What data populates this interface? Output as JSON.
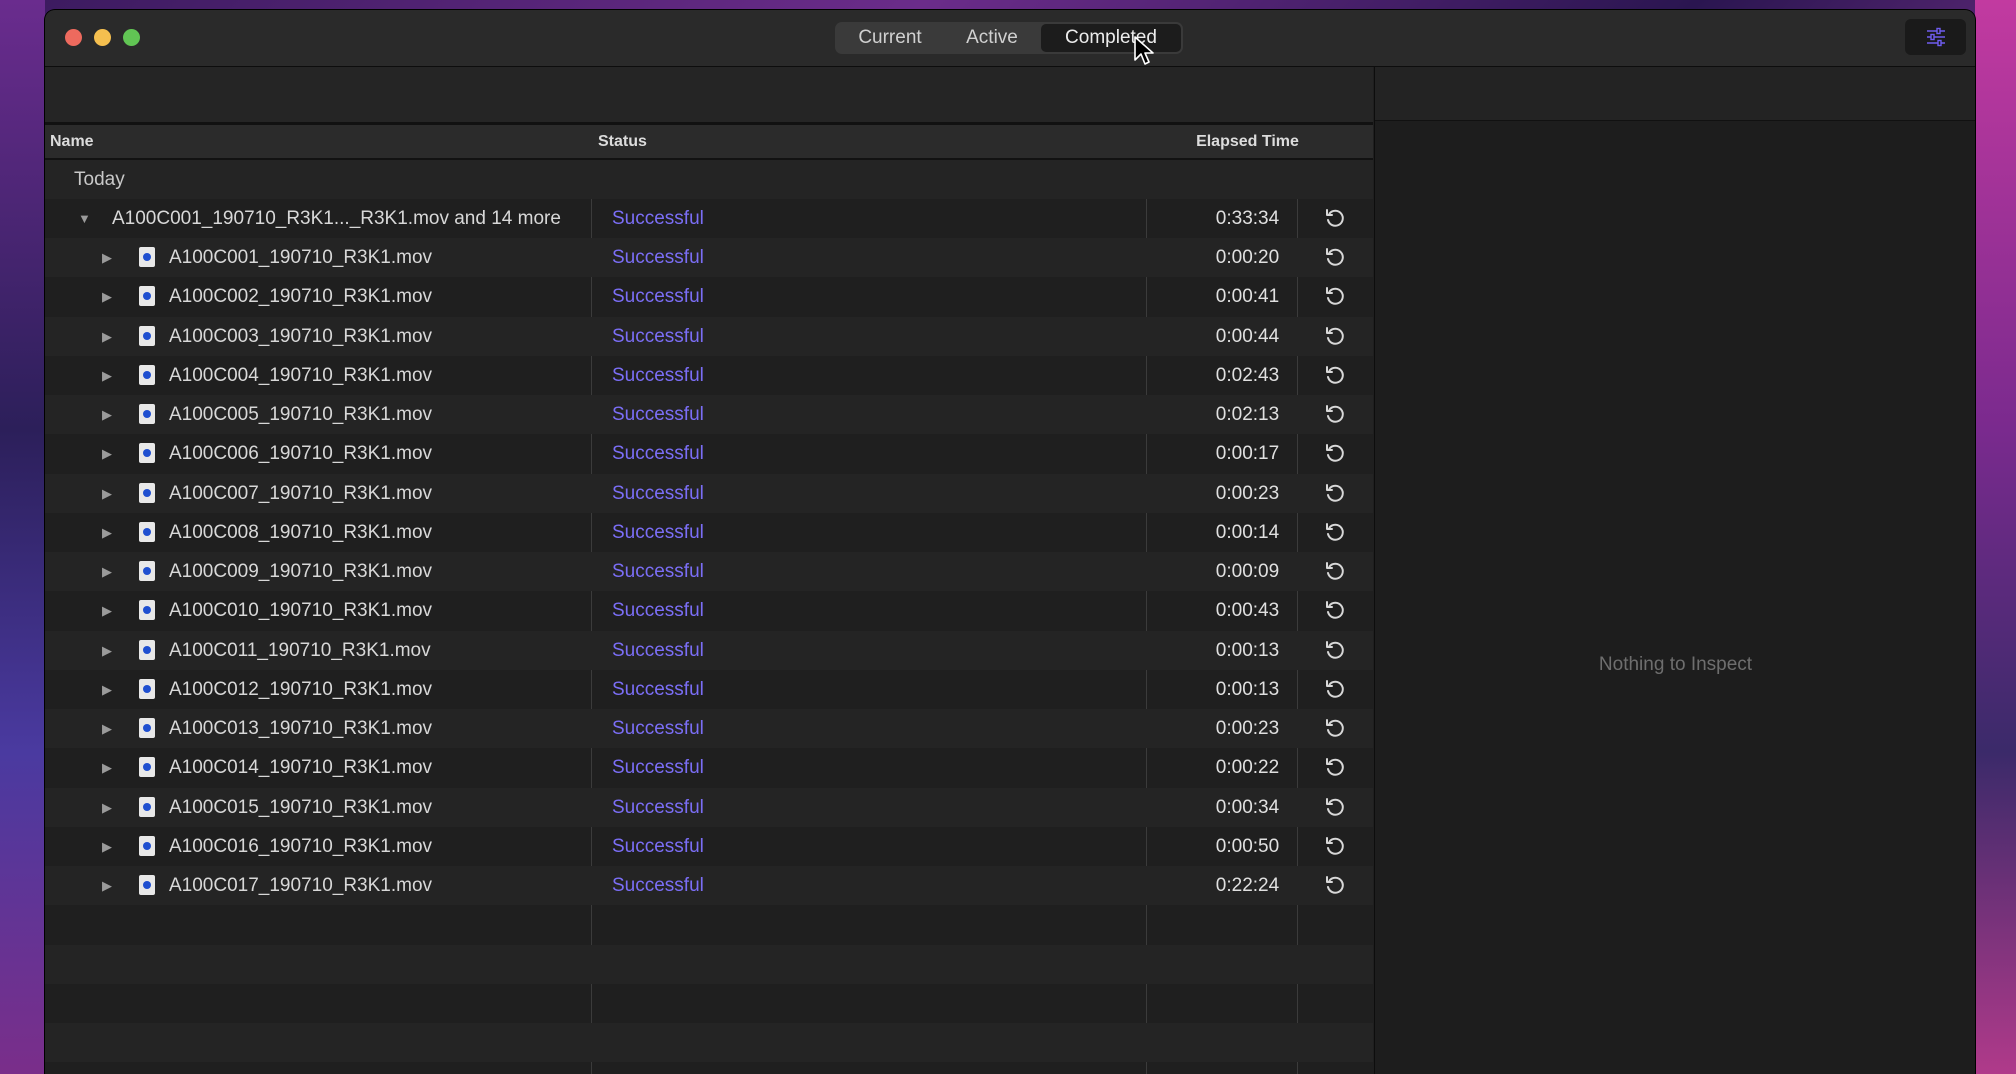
{
  "window": {
    "tabs": [
      {
        "label": "Current"
      },
      {
        "label": "Active"
      },
      {
        "label": "Completed",
        "selected": true
      }
    ],
    "inspector_toggle_icon": "sliders-icon"
  },
  "table": {
    "columns": {
      "name": "Name",
      "status": "Status",
      "elapsed": "Elapsed Time"
    },
    "group_label": "Today",
    "batch": {
      "name": "A100C001_190710_R3K1..._R3K1.mov and 14 more",
      "status": "Successful",
      "elapsed": "0:33:34",
      "expanded": true
    },
    "files": [
      {
        "name": "A100C001_190710_R3K1.mov",
        "status": "Successful",
        "elapsed": "0:00:20"
      },
      {
        "name": "A100C002_190710_R3K1.mov",
        "status": "Successful",
        "elapsed": "0:00:41"
      },
      {
        "name": "A100C003_190710_R3K1.mov",
        "status": "Successful",
        "elapsed": "0:00:44"
      },
      {
        "name": "A100C004_190710_R3K1.mov",
        "status": "Successful",
        "elapsed": "0:02:43"
      },
      {
        "name": "A100C005_190710_R3K1.mov",
        "status": "Successful",
        "elapsed": "0:02:13"
      },
      {
        "name": "A100C006_190710_R3K1.mov",
        "status": "Successful",
        "elapsed": "0:00:17"
      },
      {
        "name": "A100C007_190710_R3K1.mov",
        "status": "Successful",
        "elapsed": "0:00:23"
      },
      {
        "name": "A100C008_190710_R3K1.mov",
        "status": "Successful",
        "elapsed": "0:00:14"
      },
      {
        "name": "A100C009_190710_R3K1.mov",
        "status": "Successful",
        "elapsed": "0:00:09"
      },
      {
        "name": "A100C010_190710_R3K1.mov",
        "status": "Successful",
        "elapsed": "0:00:43"
      },
      {
        "name": "A100C011_190710_R3K1.mov",
        "status": "Successful",
        "elapsed": "0:00:13"
      },
      {
        "name": "A100C012_190710_R3K1.mov",
        "status": "Successful",
        "elapsed": "0:00:13"
      },
      {
        "name": "A100C013_190710_R3K1.mov",
        "status": "Successful",
        "elapsed": "0:00:23"
      },
      {
        "name": "A100C014_190710_R3K1.mov",
        "status": "Successful",
        "elapsed": "0:00:22"
      },
      {
        "name": "A100C015_190710_R3K1.mov",
        "status": "Successful",
        "elapsed": "0:00:34"
      },
      {
        "name": "A100C016_190710_R3K1.mov",
        "status": "Successful",
        "elapsed": "0:00:50"
      },
      {
        "name": "A100C017_190710_R3K1.mov",
        "status": "Successful",
        "elapsed": "0:22:24"
      }
    ]
  },
  "inspector": {
    "empty_text": "Nothing to Inspect"
  },
  "colors": {
    "status_success": "#7b6ef6",
    "window_bg": "#1f1f1f"
  }
}
